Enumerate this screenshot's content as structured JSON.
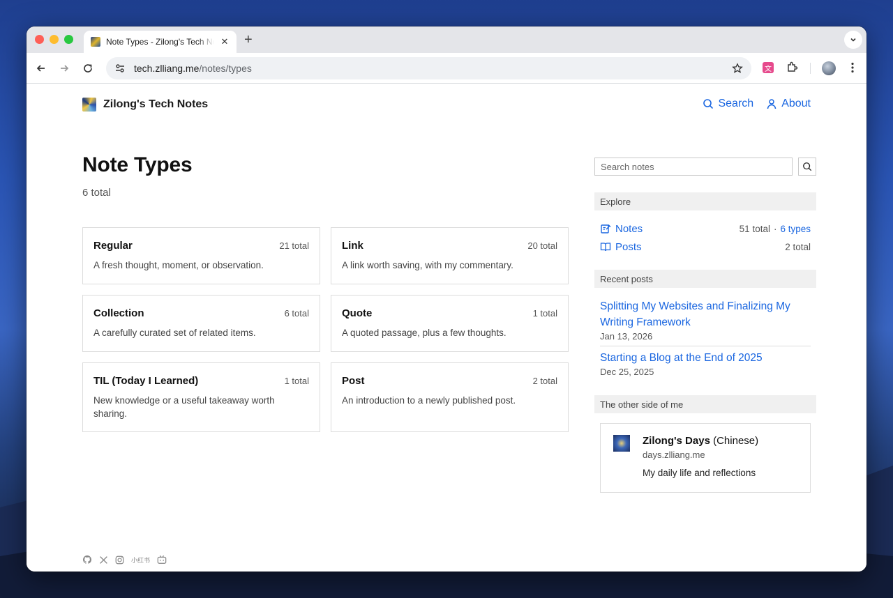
{
  "browser": {
    "tab_title": "Note Types - Zilong's Tech Notes",
    "url_host": "tech.zlliang.me",
    "url_path": "/notes/types"
  },
  "header": {
    "site_title": "Zilong's Tech Notes",
    "nav": {
      "search": "Search",
      "about": "About"
    }
  },
  "main": {
    "title": "Note Types",
    "subtitle": "6 total",
    "types": [
      {
        "name": "Regular",
        "count": "21 total",
        "desc": "A fresh thought, moment, or observation."
      },
      {
        "name": "Link",
        "count": "20 total",
        "desc": "A link worth saving, with my commentary."
      },
      {
        "name": "Collection",
        "count": "6 total",
        "desc": "A carefully curated set of related items."
      },
      {
        "name": "Quote",
        "count": "1 total",
        "desc": "A quoted passage, plus a few thoughts."
      },
      {
        "name": "TIL (Today I Learned)",
        "count": "1 total",
        "desc": "New knowledge or a useful takeaway worth sharing."
      },
      {
        "name": "Post",
        "count": "2 total",
        "desc": "An introduction to a newly published post."
      }
    ]
  },
  "sidebar": {
    "search_placeholder": "Search notes",
    "explore": {
      "heading": "Explore",
      "notes_label": "Notes",
      "notes_count": "51 total",
      "notes_types": "6 types",
      "posts_label": "Posts",
      "posts_count": "2 total"
    },
    "recent": {
      "heading": "Recent posts",
      "items": [
        {
          "title": "Splitting My Websites and Finalizing My Writing Framework",
          "date": "Jan 13, 2026"
        },
        {
          "title": "Starting a Blog at the End of 2025",
          "date": "Dec 25, 2025"
        }
      ]
    },
    "other": {
      "heading": "The other side of me",
      "name": "Zilong's Days",
      "name_suffix": "(Chinese)",
      "url": "days.zlliang.me",
      "desc": "My daily life and reflections"
    }
  },
  "footer": {
    "icons": [
      "github-icon",
      "x-icon",
      "instagram-icon",
      "xiaohongshu-icon",
      "bilibili-icon"
    ],
    "xiaohongshu_label": "小红书"
  }
}
